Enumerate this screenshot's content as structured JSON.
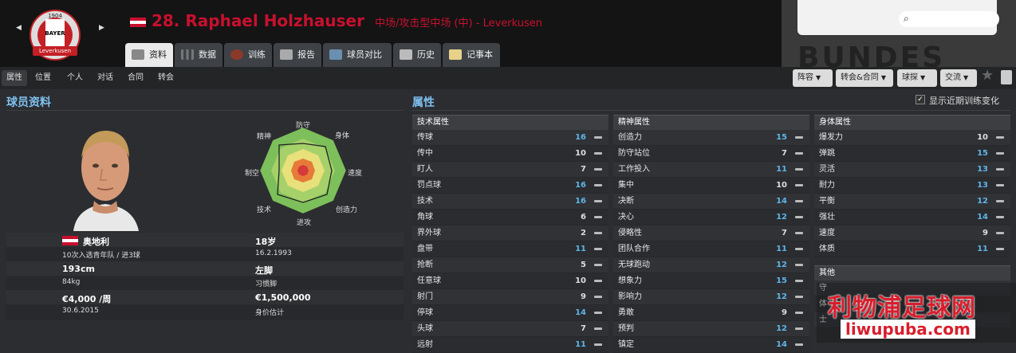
{
  "header": {
    "player_number_name": "28. Raphael Holzhauser",
    "position_club": "中场/攻击型中场 (中) - Leverkusen",
    "crest": {
      "year": "1904",
      "text": "BAYER",
      "ribbon": "Leverkusen"
    },
    "banner_text": "BUNDES",
    "tabs": [
      {
        "label": "资料",
        "icon": "profile-icon",
        "active": true
      },
      {
        "label": "数据",
        "icon": "bar-chart-icon"
      },
      {
        "label": "训练",
        "icon": "ball-icon"
      },
      {
        "label": "报告",
        "icon": "report-icon"
      },
      {
        "label": "球员对比",
        "icon": "compare-icon"
      },
      {
        "label": "历史",
        "icon": "history-icon"
      },
      {
        "label": "记事本",
        "icon": "notepad-icon"
      }
    ],
    "search_icon": "magnifier-icon"
  },
  "subtabs": [
    "属性",
    "位置",
    "个人",
    "对话",
    "合同",
    "转会"
  ],
  "actions": [
    "阵容",
    "转会&合同",
    "球探",
    "交流"
  ],
  "profile": {
    "section_title": "球员资料",
    "radar_labels": {
      "top": "防守",
      "top_right": "身体",
      "right": "速度",
      "bottom_right": "创造力",
      "bottom": "进攻",
      "bottom_left": "技术",
      "left": "制空",
      "top_left": "精神"
    },
    "nationality": "奥地利",
    "youth": "10次入选青年队 / 进3球",
    "age": "18岁",
    "dob": "16.2.1993",
    "height": "193cm",
    "weight": "84kg",
    "foot": "左脚",
    "foot_label": "习惯脚",
    "wage": "€4,000 /周",
    "contract_end": "30.6.2015",
    "value": "€1,500,000",
    "value_label": "身价估计"
  },
  "attributes": {
    "section_title": "属性",
    "show_training": "显示近期训练变化",
    "technical": {
      "title": "技术属性",
      "rows": [
        {
          "name": "传球",
          "value": "16"
        },
        {
          "name": "传中",
          "value": "10"
        },
        {
          "name": "盯人",
          "value": "7"
        },
        {
          "name": "罚点球",
          "value": "16"
        },
        {
          "name": "技术",
          "value": "16"
        },
        {
          "name": "角球",
          "value": "6"
        },
        {
          "name": "界外球",
          "value": "2"
        },
        {
          "name": "盘带",
          "value": "11"
        },
        {
          "name": "抢断",
          "value": "5"
        },
        {
          "name": "任意球",
          "value": "10"
        },
        {
          "name": "射门",
          "value": "9"
        },
        {
          "name": "停球",
          "value": "14"
        },
        {
          "name": "头球",
          "value": "7"
        },
        {
          "name": "远射",
          "value": "11"
        }
      ]
    },
    "mental": {
      "title": "精神属性",
      "rows": [
        {
          "name": "创造力",
          "value": "15"
        },
        {
          "name": "防守站位",
          "value": "7"
        },
        {
          "name": "工作投入",
          "value": "11"
        },
        {
          "name": "集中",
          "value": "10"
        },
        {
          "name": "决断",
          "value": "14"
        },
        {
          "name": "决心",
          "value": "12"
        },
        {
          "name": "侵略性",
          "value": "7"
        },
        {
          "name": "团队合作",
          "value": "11"
        },
        {
          "name": "无球跑动",
          "value": "12"
        },
        {
          "name": "想象力",
          "value": "15"
        },
        {
          "name": "影响力",
          "value": "12"
        },
        {
          "name": "勇敢",
          "value": "9"
        },
        {
          "name": "预判",
          "value": "12"
        },
        {
          "name": "镇定",
          "value": "14"
        }
      ]
    },
    "physical": {
      "title": "身体属性",
      "rows": [
        {
          "name": "爆发力",
          "value": "10"
        },
        {
          "name": "弹跳",
          "value": "15"
        },
        {
          "name": "灵活",
          "value": "13"
        },
        {
          "name": "耐力",
          "value": "13"
        },
        {
          "name": "平衡",
          "value": "12"
        },
        {
          "name": "强壮",
          "value": "14"
        },
        {
          "name": "速度",
          "value": "9"
        },
        {
          "name": "体质",
          "value": "11"
        }
      ]
    },
    "other": {
      "title": "其他",
      "rows": [
        {
          "name": "守"
        },
        {
          "name": "体"
        },
        {
          "name": "士"
        }
      ]
    }
  },
  "watermark": {
    "cn": "利物浦足球网",
    "url": "liwupuba.com"
  },
  "colors": {
    "accent_blue": "#5fb4e8",
    "name_red": "#c8102e"
  }
}
